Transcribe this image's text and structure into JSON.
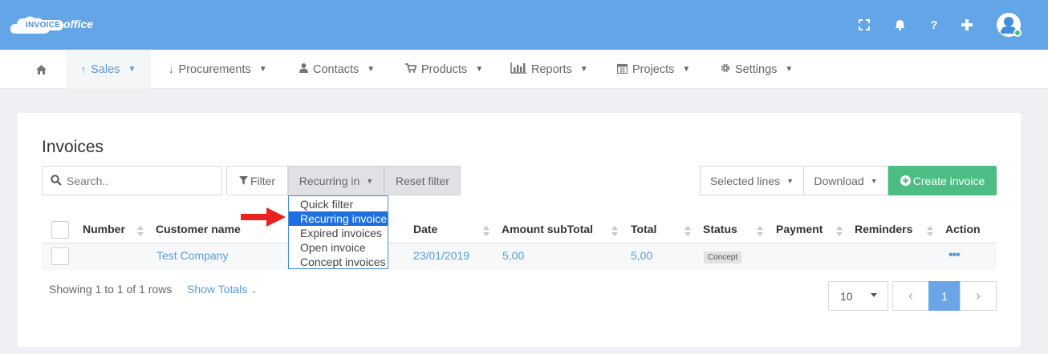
{
  "app": {
    "logo_badge": "INVOICE",
    "logo_text": "office"
  },
  "topbar": {
    "icons": [
      "fullscreen-icon",
      "bell-icon",
      "help-icon",
      "plus-icon",
      "user-avatar"
    ]
  },
  "nav": {
    "items": [
      {
        "label": "",
        "icon": "home-icon"
      },
      {
        "label": "Sales",
        "icon": "arrow-up-icon",
        "active": true
      },
      {
        "label": "Procurements",
        "icon": "arrow-down-icon"
      },
      {
        "label": "Contacts",
        "icon": "user-icon"
      },
      {
        "label": "Products",
        "icon": "cart-icon"
      },
      {
        "label": "Reports",
        "icon": "bar-chart-icon"
      },
      {
        "label": "Projects",
        "icon": "calendar-icon"
      },
      {
        "label": "Settings",
        "icon": "gear-icon"
      }
    ]
  },
  "page": {
    "title": "Invoices"
  },
  "toolbar": {
    "search_placeholder": "Search..",
    "filter_label": "Filter",
    "recurring_label": "Recurring in",
    "reset_label": "Reset filter",
    "selected_lines_label": "Selected lines",
    "download_label": "Download",
    "create_label": "Create invoice"
  },
  "dropdown": {
    "options": [
      "Quick filter",
      "Recurring invoice",
      "Expired invoices",
      "Open invoice",
      "Concept invoices"
    ],
    "selected": "Recurring invoice"
  },
  "table": {
    "columns": [
      "Number",
      "Customer name",
      "Date",
      "Amount subTotal",
      "Total",
      "Status",
      "Payment",
      "Reminders",
      "Action"
    ],
    "rows": [
      {
        "number": "",
        "customer": "Test Company",
        "date": "23/01/2019",
        "amount_subtotal": "5,00",
        "total": "5,00",
        "status": "Concept",
        "payment": "",
        "reminders": "",
        "action": "•••"
      }
    ]
  },
  "footer": {
    "showing": "Showing 1 to 1 of 1 rows",
    "show_totals": "Show Totals",
    "page_size": "10",
    "current_page": "1",
    "prev": "‹",
    "next": "›"
  },
  "colors": {
    "topbar": "#64a5e8",
    "accent": "#5b9bd5",
    "create_button": "#4cbd83",
    "selected_option": "#1e6fe0",
    "annotation_arrow": "#e8231f"
  }
}
